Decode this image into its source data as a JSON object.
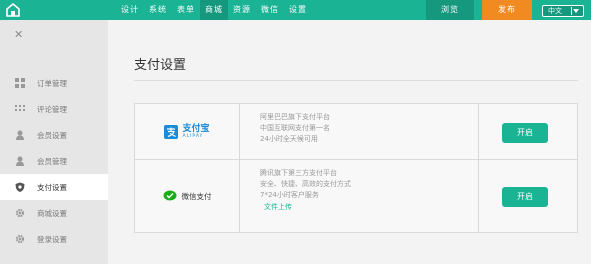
{
  "topbar": {
    "logo_icon": "home-icon",
    "nav": [
      {
        "label": "设计",
        "active": false
      },
      {
        "label": "系统",
        "active": false
      },
      {
        "label": "表单",
        "active": false
      },
      {
        "label": "商城",
        "active": true
      },
      {
        "label": "资源",
        "active": false
      },
      {
        "label": "微信",
        "active": false
      },
      {
        "label": "设置",
        "active": false
      }
    ],
    "browse_label": "浏览",
    "publish_label": "发布",
    "language": "中文",
    "colors": {
      "bar": "#1ab394",
      "active": "#16987e",
      "publish": "#f28a22"
    }
  },
  "sidebar": {
    "close_icon": "close-icon",
    "close_glyph": "✕",
    "items": [
      {
        "label": "订单管理",
        "icon": "grid-icon",
        "active": false
      },
      {
        "label": "评论管理",
        "icon": "dots-grid-icon",
        "active": false
      },
      {
        "label": "会员设置",
        "icon": "user-icon",
        "active": false
      },
      {
        "label": "会员管理",
        "icon": "user-icon",
        "active": false
      },
      {
        "label": "支付设置",
        "icon": "shield-icon",
        "active": true
      },
      {
        "label": "商城设置",
        "icon": "gear-icon",
        "active": false
      },
      {
        "label": "登录设置",
        "icon": "gear-icon",
        "active": false
      }
    ]
  },
  "main": {
    "title": "支付设置",
    "payments": [
      {
        "name": "支付宝",
        "name_en": "ALIPAY",
        "icon": "alipay-icon",
        "lines": [
          "阿里巴巴旗下支付平台",
          "中国互联网支付第一名",
          "24小时全天候可用"
        ],
        "button_label": "开启"
      },
      {
        "name": "微信支付",
        "icon": "wechat-pay-icon",
        "lines": [
          "腾讯旗下第三方支付平台",
          "安全、快捷、高效的支付方式",
          "7*24小时客户服务"
        ],
        "link_label": "文件上传",
        "button_label": "开启"
      }
    ]
  }
}
